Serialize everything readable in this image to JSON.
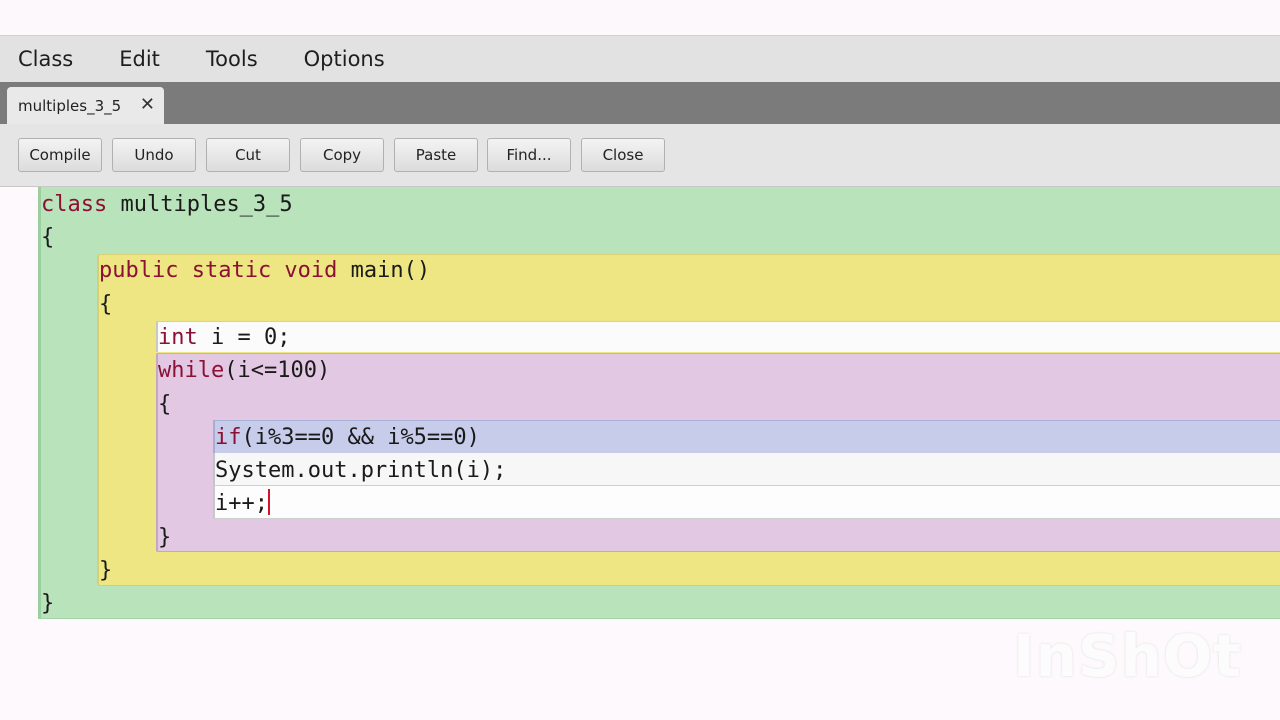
{
  "menubar": {
    "items": [
      "Class",
      "Edit",
      "Tools",
      "Options"
    ]
  },
  "tab": {
    "label": "multiples_3_5",
    "close_glyph": "✕"
  },
  "toolbar": {
    "buttons": [
      "Compile",
      "Undo",
      "Cut",
      "Copy",
      "Paste",
      "Find...",
      "Close"
    ]
  },
  "code": {
    "line1_kw": "class",
    "line1_rest": " multiples_3_5",
    "line2": "{",
    "line3_kw": "public static void",
    "line3_rest": " main()",
    "line4": "{",
    "line5_kw": "int",
    "line5_rest": " i = 0;",
    "line6_kw": "while",
    "line6_rest": "(i<=100)",
    "line7": "{",
    "line8_kw": "if",
    "line8_rest": "(i%3==0 && i%5==0)",
    "line9": "System.out.println(i);",
    "line10": "i++;",
    "line11": "}",
    "line12": "}",
    "line13": "}"
  },
  "watermark": "InShOt",
  "colors": {
    "class_scope": "#b9e3bb",
    "method_scope": "#ede683",
    "while_scope": "#e3c8e3",
    "if_scope": "#c6cce9",
    "keyword": "#8b1034"
  }
}
